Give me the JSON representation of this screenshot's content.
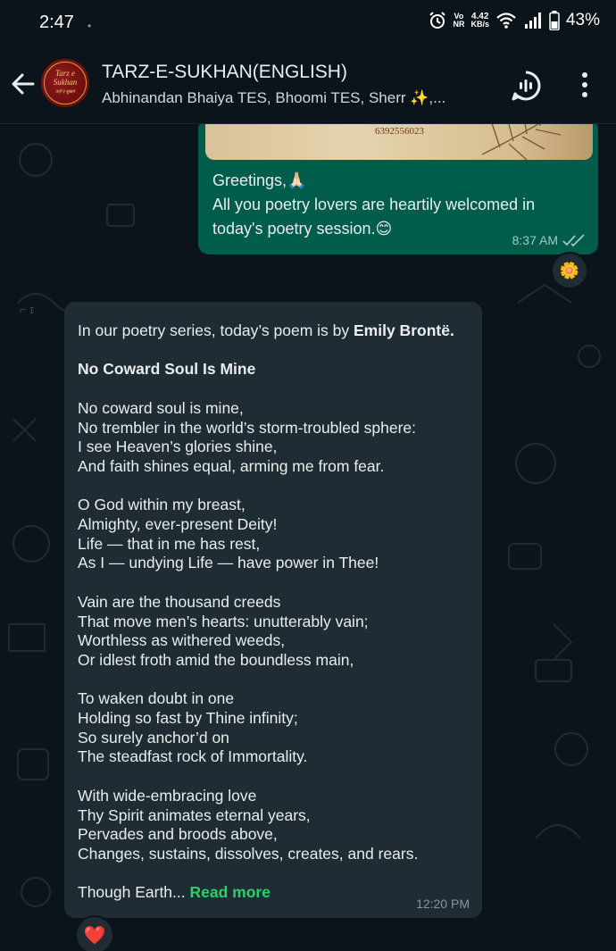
{
  "status_bar": {
    "time": "2:47",
    "dot": "•",
    "vo": "Vo",
    "nr": "NR",
    "speed_value": "4.42",
    "speed_unit": "KB/s",
    "battery": "43%"
  },
  "header": {
    "title": "TARZ-E-SUKHAN(ENGLISH)",
    "members": "Abhinandan Bhaiya TES, Bhoomi TES, Sherr ✨,...",
    "avatar_text": "Tarz e Sukhan",
    "avatar_subtext": "तर्ज़ ए सुख़न"
  },
  "messages": {
    "outgoing": {
      "image_caption_phone": "6392556023",
      "line1": "Greetings,🙏🏻",
      "line2": "All you poetry lovers are heartily welcomed in today's poetry session.😊",
      "time": "8:37 AM",
      "reaction": "🌼"
    },
    "incoming": {
      "intro": "In our poetry series, today’s poem is by ",
      "author": "Emily Brontë.",
      "poem_title": "No Coward Soul Is Mine",
      "stanza1": "No coward soul is mine,\nNo trembler in the world’s storm-troubled sphere:\nI see Heaven’s glories shine,\nAnd faith shines equal, arming me from fear.",
      "stanza2": "O God within my breast,\nAlmighty, ever-present Deity!\nLife — that in me has rest,\nAs I — undying Life — have power in Thee!",
      "stanza3": "Vain are the thousand creeds\nThat move men’s hearts: unutterably vain;\nWorthless as withered weeds,\nOr idlest froth amid the boundless main,",
      "stanza4": "To waken doubt in one\nHolding so fast by Thine infinity;\nSo surely anchor’d on\nThe steadfast rock of Immortality.",
      "stanza5": "With wide-embracing love\nThy Spirit animates eternal years,\nPervades and broods above,\nChanges, sustains, dissolves, creates, and rears.",
      "truncated": "Though Earth... ",
      "read_more": "Read more",
      "time": "12:20 PM",
      "reaction": "❤️"
    }
  },
  "colors": {
    "background": "#0b141a",
    "outgoing_bubble": "#005c4b",
    "incoming_bubble": "#1f2c33",
    "read_more": "#25d366",
    "read_ticks": "#a9c7bf"
  },
  "icons": {
    "back": "arrow-left-icon",
    "call": "group-call-icon",
    "menu": "more-vertical-icon",
    "alarm": "alarm-icon",
    "wifi": "wifi-icon",
    "signal": "signal-icon",
    "battery": "battery-icon",
    "ticks": "double-check-icon"
  }
}
